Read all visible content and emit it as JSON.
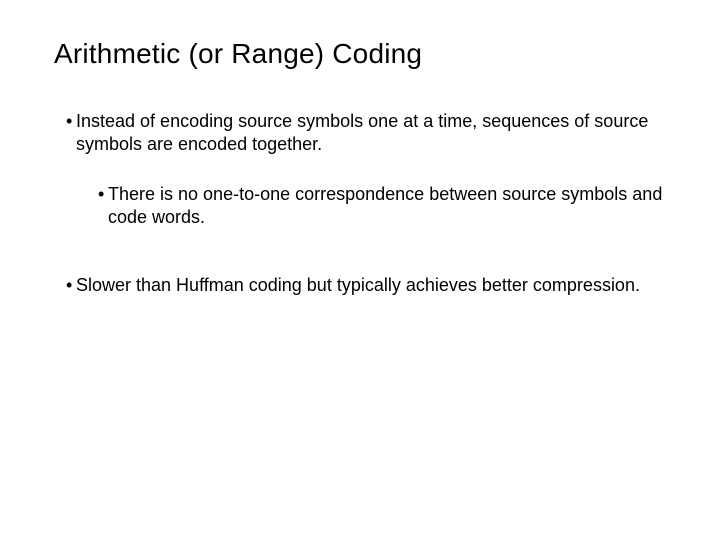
{
  "slide": {
    "title": "Arithmetic (or Range) Coding",
    "bullets": [
      {
        "level": 1,
        "text": "Instead of encoding source symbols one at a time, sequences of source symbols are encoded together."
      },
      {
        "level": 2,
        "text": "There is no one-to-one correspondence between source symbols and code words."
      },
      {
        "level": 1,
        "text": "Slower than Huffman coding but typically achieves better compression."
      }
    ]
  }
}
